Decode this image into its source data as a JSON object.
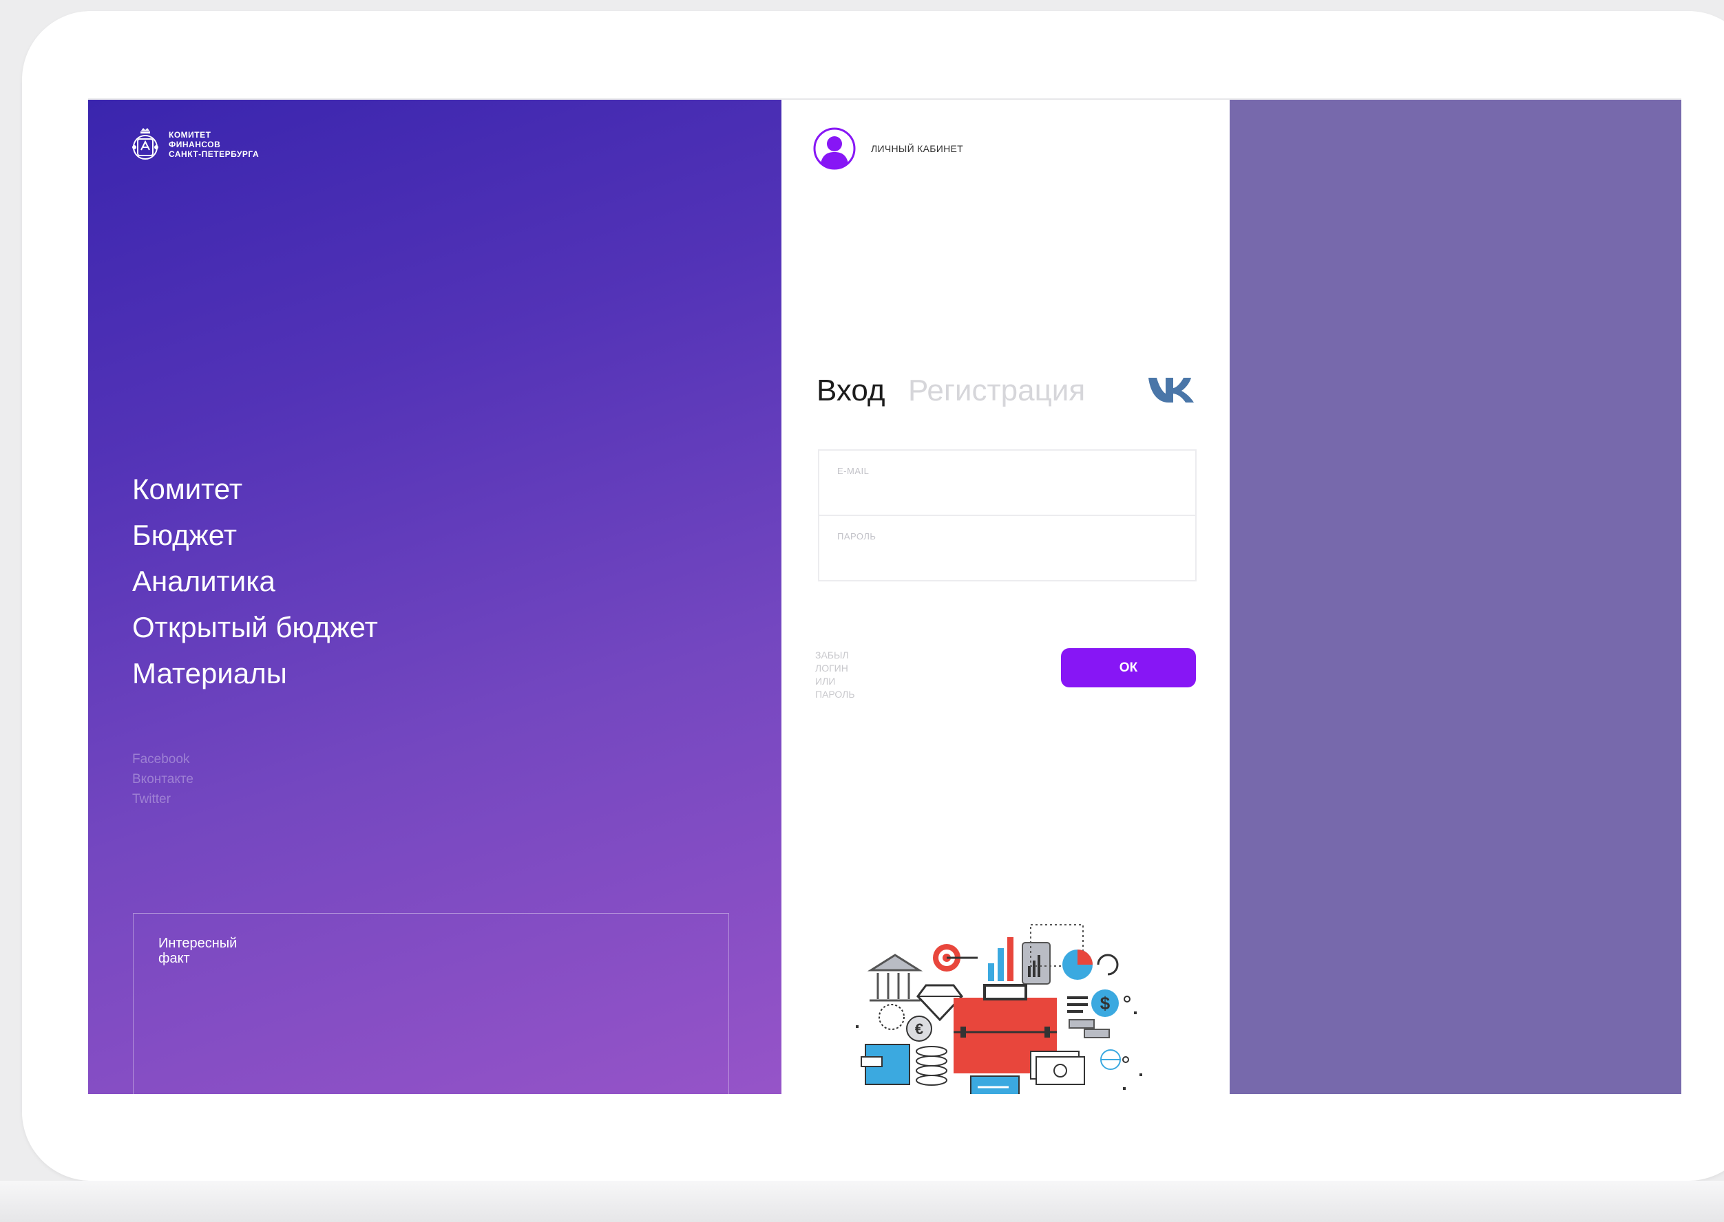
{
  "brand": {
    "line1": "КОМИТЕТ",
    "line2": "ФИНАНСОВ",
    "line3": "САНКТ-ПЕТЕРБУРГА"
  },
  "nav": {
    "items": [
      "Комитет",
      "Бюджет",
      "Аналитика",
      "Открытый бюджет",
      "Материалы"
    ]
  },
  "social": {
    "items": [
      "Facebook",
      "Вконтакте",
      "Twitter"
    ]
  },
  "fact": {
    "label": "Интересный факт"
  },
  "account": {
    "label": "ЛИЧНЫЙ КАБИНЕТ"
  },
  "auth": {
    "tab_login": "Вход",
    "tab_register": "Регистрация",
    "email_label": "E-MAIL",
    "email_value": "",
    "password_label": "ПАРОЛЬ",
    "password_value": "",
    "forgot": "ЗАБЫЛ ЛОГИН ИЛИ ПАРОЛЬ",
    "submit": "ОК"
  },
  "colors": {
    "gradient_start": "#3a25ae",
    "gradient_end": "#9654c8",
    "accent": "#8716f5",
    "side_panel": "#7769ac",
    "vk": "#4a76a8"
  },
  "icons": {
    "logo": "emblem-icon",
    "account": "user-icon",
    "social_login": "vk-icon",
    "illustration": "finance-illustration"
  }
}
